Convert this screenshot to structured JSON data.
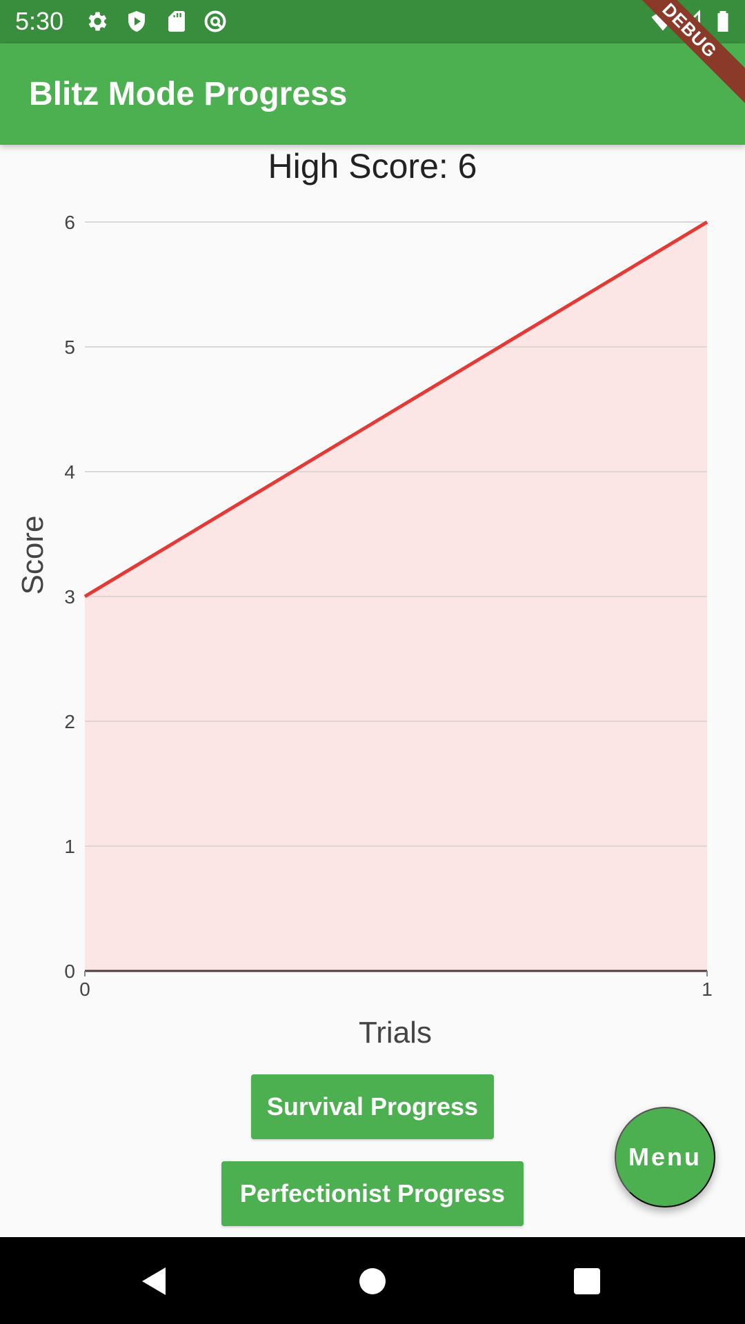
{
  "status_bar": {
    "time": "5:30",
    "left_icons": [
      "gear-icon",
      "shield-play-icon",
      "sd-card-icon",
      "at-circle-icon"
    ],
    "right_icons": [
      "wifi-icon",
      "signal-icon",
      "battery-icon"
    ]
  },
  "app_bar": {
    "title": "Blitz Mode Progress",
    "debug_banner": "DEBUG"
  },
  "colors": {
    "primary": "#4caf50",
    "primary_dark": "#388e3c",
    "line": "#e53935",
    "area_fill": "#fbe6e5"
  },
  "high_score_label": "High Score: 6",
  "chart_data": {
    "type": "area",
    "title": "High Score: 6",
    "xlabel": "Trials",
    "ylabel": "Score",
    "x": [
      0,
      1
    ],
    "series": [
      {
        "name": "Score",
        "values": [
          3,
          6
        ]
      }
    ],
    "xlim": [
      0,
      1
    ],
    "ylim": [
      0,
      6
    ],
    "x_ticks": [
      "0",
      "1"
    ],
    "y_ticks": [
      "0",
      "1",
      "2",
      "3",
      "4",
      "5",
      "6"
    ],
    "grid": true,
    "legend": "none"
  },
  "buttons": {
    "survival": "Survival Progress",
    "perfectionist": "Perfectionist Progress",
    "menu": "Menu"
  },
  "nav_bar": {
    "back": "back-icon",
    "home": "home-icon",
    "recents": "recents-icon"
  }
}
